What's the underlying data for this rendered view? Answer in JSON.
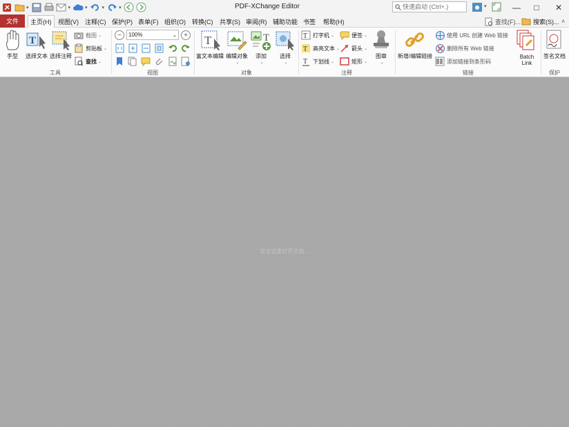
{
  "app": {
    "title": "PDF-XChange Editor"
  },
  "search": {
    "placeholder": "快速启动 (Ctrl+.)"
  },
  "menu": {
    "file": "文件",
    "items": [
      "主页(H)",
      "视图(V)",
      "注释(C)",
      "保护(P)",
      "表单(F)",
      "组织(O)",
      "转换(C)",
      "共享(S)",
      "审阅(R)",
      "辅助功能",
      "书签",
      "帮助(H)"
    ],
    "find": "查找(F)...",
    "search": "搜索(S)..."
  },
  "ribbon": {
    "tools": {
      "label": "工具",
      "hand": "手型",
      "select_text": "选择文本",
      "select_comment": "选择注释",
      "snapshot": "截图",
      "clipboard": "剪贴板",
      "find": "查找"
    },
    "view": {
      "label": "视图",
      "zoom": "100%"
    },
    "objects": {
      "label": "对象",
      "edit_text": "富文本编辑",
      "edit_objects": "编辑对象",
      "add": "添加",
      "select": "选择"
    },
    "comment": {
      "label": "注释",
      "typewriter": "打字机",
      "note": "便签",
      "highlight": "高亮文本",
      "arrow": "箭头",
      "underline": "下划线",
      "rectangle": "矩形",
      "stamp": "图章"
    },
    "links": {
      "label": "链接",
      "new_edit": "新增/编辑链接",
      "create_web": "使用 URL 创建 Web 链接",
      "remove_web": "删除所有 Web 链接",
      "add_barcode": "添加链接到条形码",
      "batch_link": "Batch Link"
    },
    "protect": {
      "label": "保护",
      "sign": "签名文档"
    }
  },
  "workspace": {
    "hint": "双击这里打开文档..."
  }
}
